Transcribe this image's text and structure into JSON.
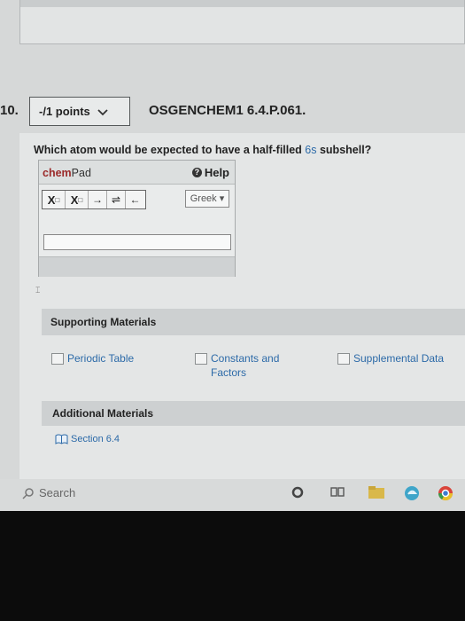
{
  "question": {
    "number": "10.",
    "points": "-/1 points",
    "code": "OSGENCHEM1 6.4.P.061.",
    "text_before": "Which atom would be expected to have a half-filled ",
    "subshell": "6s",
    "text_after": " subshell?"
  },
  "chempad": {
    "title_chem": "chem",
    "title_pad": "Pad",
    "help_label": "Help",
    "tools": {
      "subscript_base": "X",
      "subscript_mark": "□",
      "superscript_base": "X",
      "superscript_mark": "□",
      "arrow_right": "→",
      "arrow_equilibrium": "⇌",
      "arrow_left": "←"
    },
    "greek_label": "Greek ▾",
    "input_value": ""
  },
  "supporting": {
    "heading": "Supporting Materials",
    "links": [
      "Periodic Table",
      "Constants and Factors",
      "Supplemental Data"
    ]
  },
  "additional": {
    "heading": "Additional Materials",
    "section_link": "Section 6.4"
  },
  "taskbar": {
    "search_label": "Search",
    "icons": [
      "cortana-icon",
      "task-view-icon",
      "file-explorer-icon",
      "edge-icon",
      "chrome-icon"
    ]
  },
  "colors": {
    "link": "#2c6aa8",
    "chem_title": "#9b2a2a"
  }
}
